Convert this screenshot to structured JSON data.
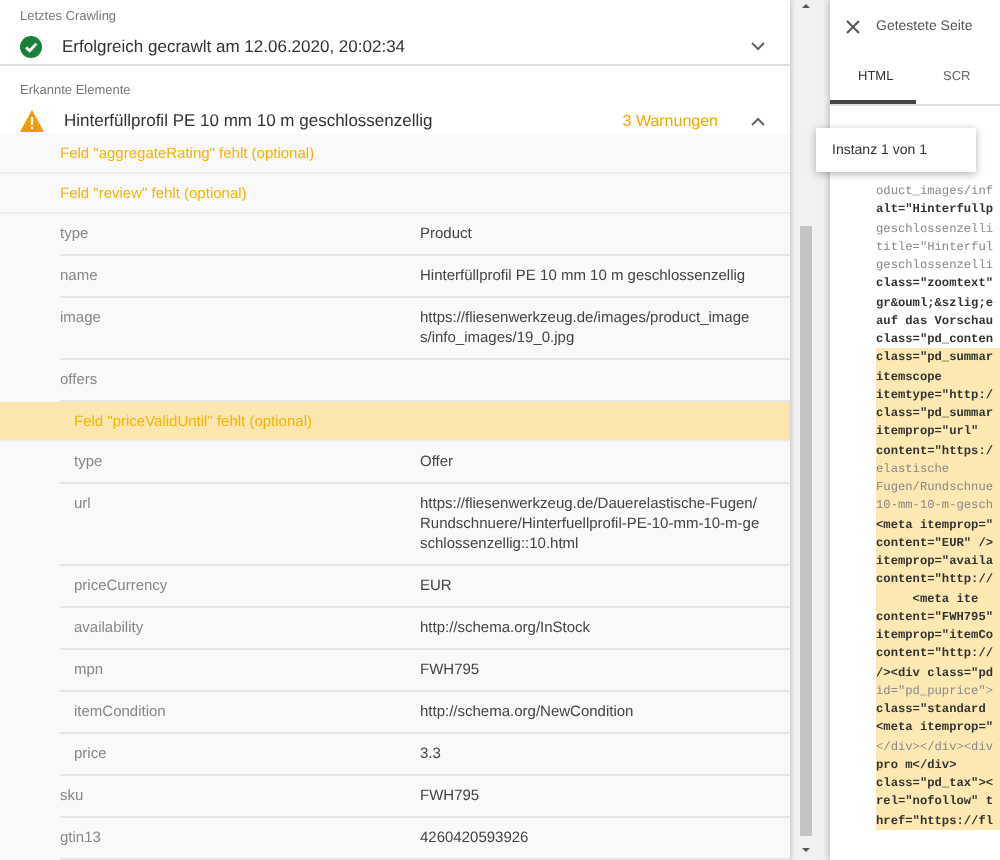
{
  "last_crawl": {
    "label": "Letztes Crawling",
    "status": "Erfolgreich gecrawlt am 12.06.2020, 20:02:34",
    "expanded": false
  },
  "detected": {
    "label": "Erkannte Elemente",
    "items": [
      {
        "title": "Hinterfüllprofil PE 10 mm 10 m geschlossenzellig",
        "warnings": "3 Warnungen",
        "expanded": true,
        "messages": [
          {
            "text": "Feld \"aggregateRating\" fehlt (optional)",
            "selected": false
          },
          {
            "text": "Feld \"review\" fehlt (optional)",
            "selected": false
          }
        ],
        "properties": [
          {
            "key": "type",
            "value": "Product"
          },
          {
            "key": "name",
            "value": "Hinterfüllprofil PE 10 mm 10 m geschlossenzellig"
          },
          {
            "key": "image",
            "value": "https://fliesenwerkzeug.de/images/product_images/info_images/19_0.jpg"
          },
          {
            "key": "offers",
            "messages": [
              {
                "text": "Feld \"priceValidUntil\" fehlt (optional)",
                "selected": true
              }
            ],
            "children": [
              {
                "key": "type",
                "value": "Offer"
              },
              {
                "key": "url",
                "value": "https://fliesenwerkzeug.de/Dauerelastische-Fugen/Rundschnuere/Hinterfuellprofil-PE-10-mm-10-m-geschlossenzellig::10.html"
              },
              {
                "key": "priceCurrency",
                "value": "EUR"
              },
              {
                "key": "availability",
                "value": "http://schema.org/InStock"
              },
              {
                "key": "mpn",
                "value": "FWH795"
              },
              {
                "key": "itemCondition",
                "value": "http://schema.org/NewCondition"
              },
              {
                "key": "price",
                "value": "3.3"
              }
            ]
          },
          {
            "key": "sku",
            "value": "FWH795"
          },
          {
            "key": "gtin13",
            "value": "4260420593926"
          }
        ]
      }
    ]
  },
  "panel": {
    "title": "Getestete Seite",
    "tabs": [
      {
        "label": "HTML",
        "selected": true
      },
      {
        "label": "SCR",
        "selected": false
      }
    ],
    "search": {
      "text": "Instanz 1 von 1"
    },
    "code": [
      {
        "text": "oduct_images/inf",
        "bold": false,
        "highlighted": false
      },
      {
        "text": "alt=\"Hinterfullp",
        "bold": true,
        "highlighted": false
      },
      {
        "text": "geschlossenzelli",
        "bold": false,
        "highlighted": false
      },
      {
        "text": "title=\"Hinterful",
        "bold": false,
        "highlighted": false
      },
      {
        "text": "geschlossenzelli",
        "bold": false,
        "highlighted": false
      },
      {
        "text": "class=\"zoomtext\"",
        "bold": true,
        "highlighted": false
      },
      {
        "text": "gr&ouml;&szlig;e",
        "bold": true,
        "highlighted": false
      },
      {
        "text": "auf das Vorschau",
        "bold": true,
        "highlighted": false
      },
      {
        "text": "class=\"pd_conten",
        "bold": true,
        "highlighted": false
      },
      {
        "text": "class=\"pd_summar",
        "bold": true,
        "highlighted": true
      },
      {
        "text": "itemscope",
        "bold": true,
        "highlighted": true
      },
      {
        "text": "itemtype=\"http:/",
        "bold": true,
        "highlighted": true
      },
      {
        "text": "class=\"pd_summar",
        "bold": true,
        "highlighted": true
      },
      {
        "text": "itemprop=\"url\"",
        "bold": true,
        "highlighted": true
      },
      {
        "text": "content=\"https:/",
        "bold": true,
        "highlighted": true
      },
      {
        "text": "elastische",
        "bold": false,
        "highlighted": true
      },
      {
        "text": "Fugen/Rundschnue",
        "bold": false,
        "highlighted": true
      },
      {
        "text": "10-mm-10-m-gesch",
        "bold": false,
        "highlighted": true
      },
      {
        "text": "<meta itemprop=\"",
        "bold": true,
        "highlighted": true
      },
      {
        "text": "content=\"EUR\" />",
        "bold": true,
        "highlighted": true
      },
      {
        "text": "itemprop=\"availa",
        "bold": true,
        "highlighted": true
      },
      {
        "text": "content=\"http://",
        "bold": true,
        "highlighted": true
      },
      {
        "text": "     <meta ite",
        "bold": true,
        "highlighted": true
      },
      {
        "text": "content=\"FWH795\"",
        "bold": true,
        "highlighted": true
      },
      {
        "text": "itemprop=\"itemCo",
        "bold": true,
        "highlighted": true
      },
      {
        "text": "content=\"http://",
        "bold": true,
        "highlighted": true
      },
      {
        "text": "/><div class=\"pd",
        "bold": true,
        "highlighted": true
      },
      {
        "text": "id=\"pd_puprice\">",
        "bold": false,
        "highlighted": true
      },
      {
        "text": "class=\"standard",
        "bold": true,
        "highlighted": true
      },
      {
        "text": "<meta itemprop=\"",
        "bold": true,
        "highlighted": true
      },
      {
        "text": "</div></div><div",
        "bold": false,
        "highlighted": true
      },
      {
        "text": "pro m</div>",
        "bold": true,
        "highlighted": true
      },
      {
        "text": "class=\"pd_tax\"><",
        "bold": true,
        "highlighted": true
      },
      {
        "text": "rel=\"nofollow\" t",
        "bold": true,
        "highlighted": true
      },
      {
        "text": "href=\"https://fl",
        "bold": true,
        "highlighted": true
      }
    ]
  }
}
